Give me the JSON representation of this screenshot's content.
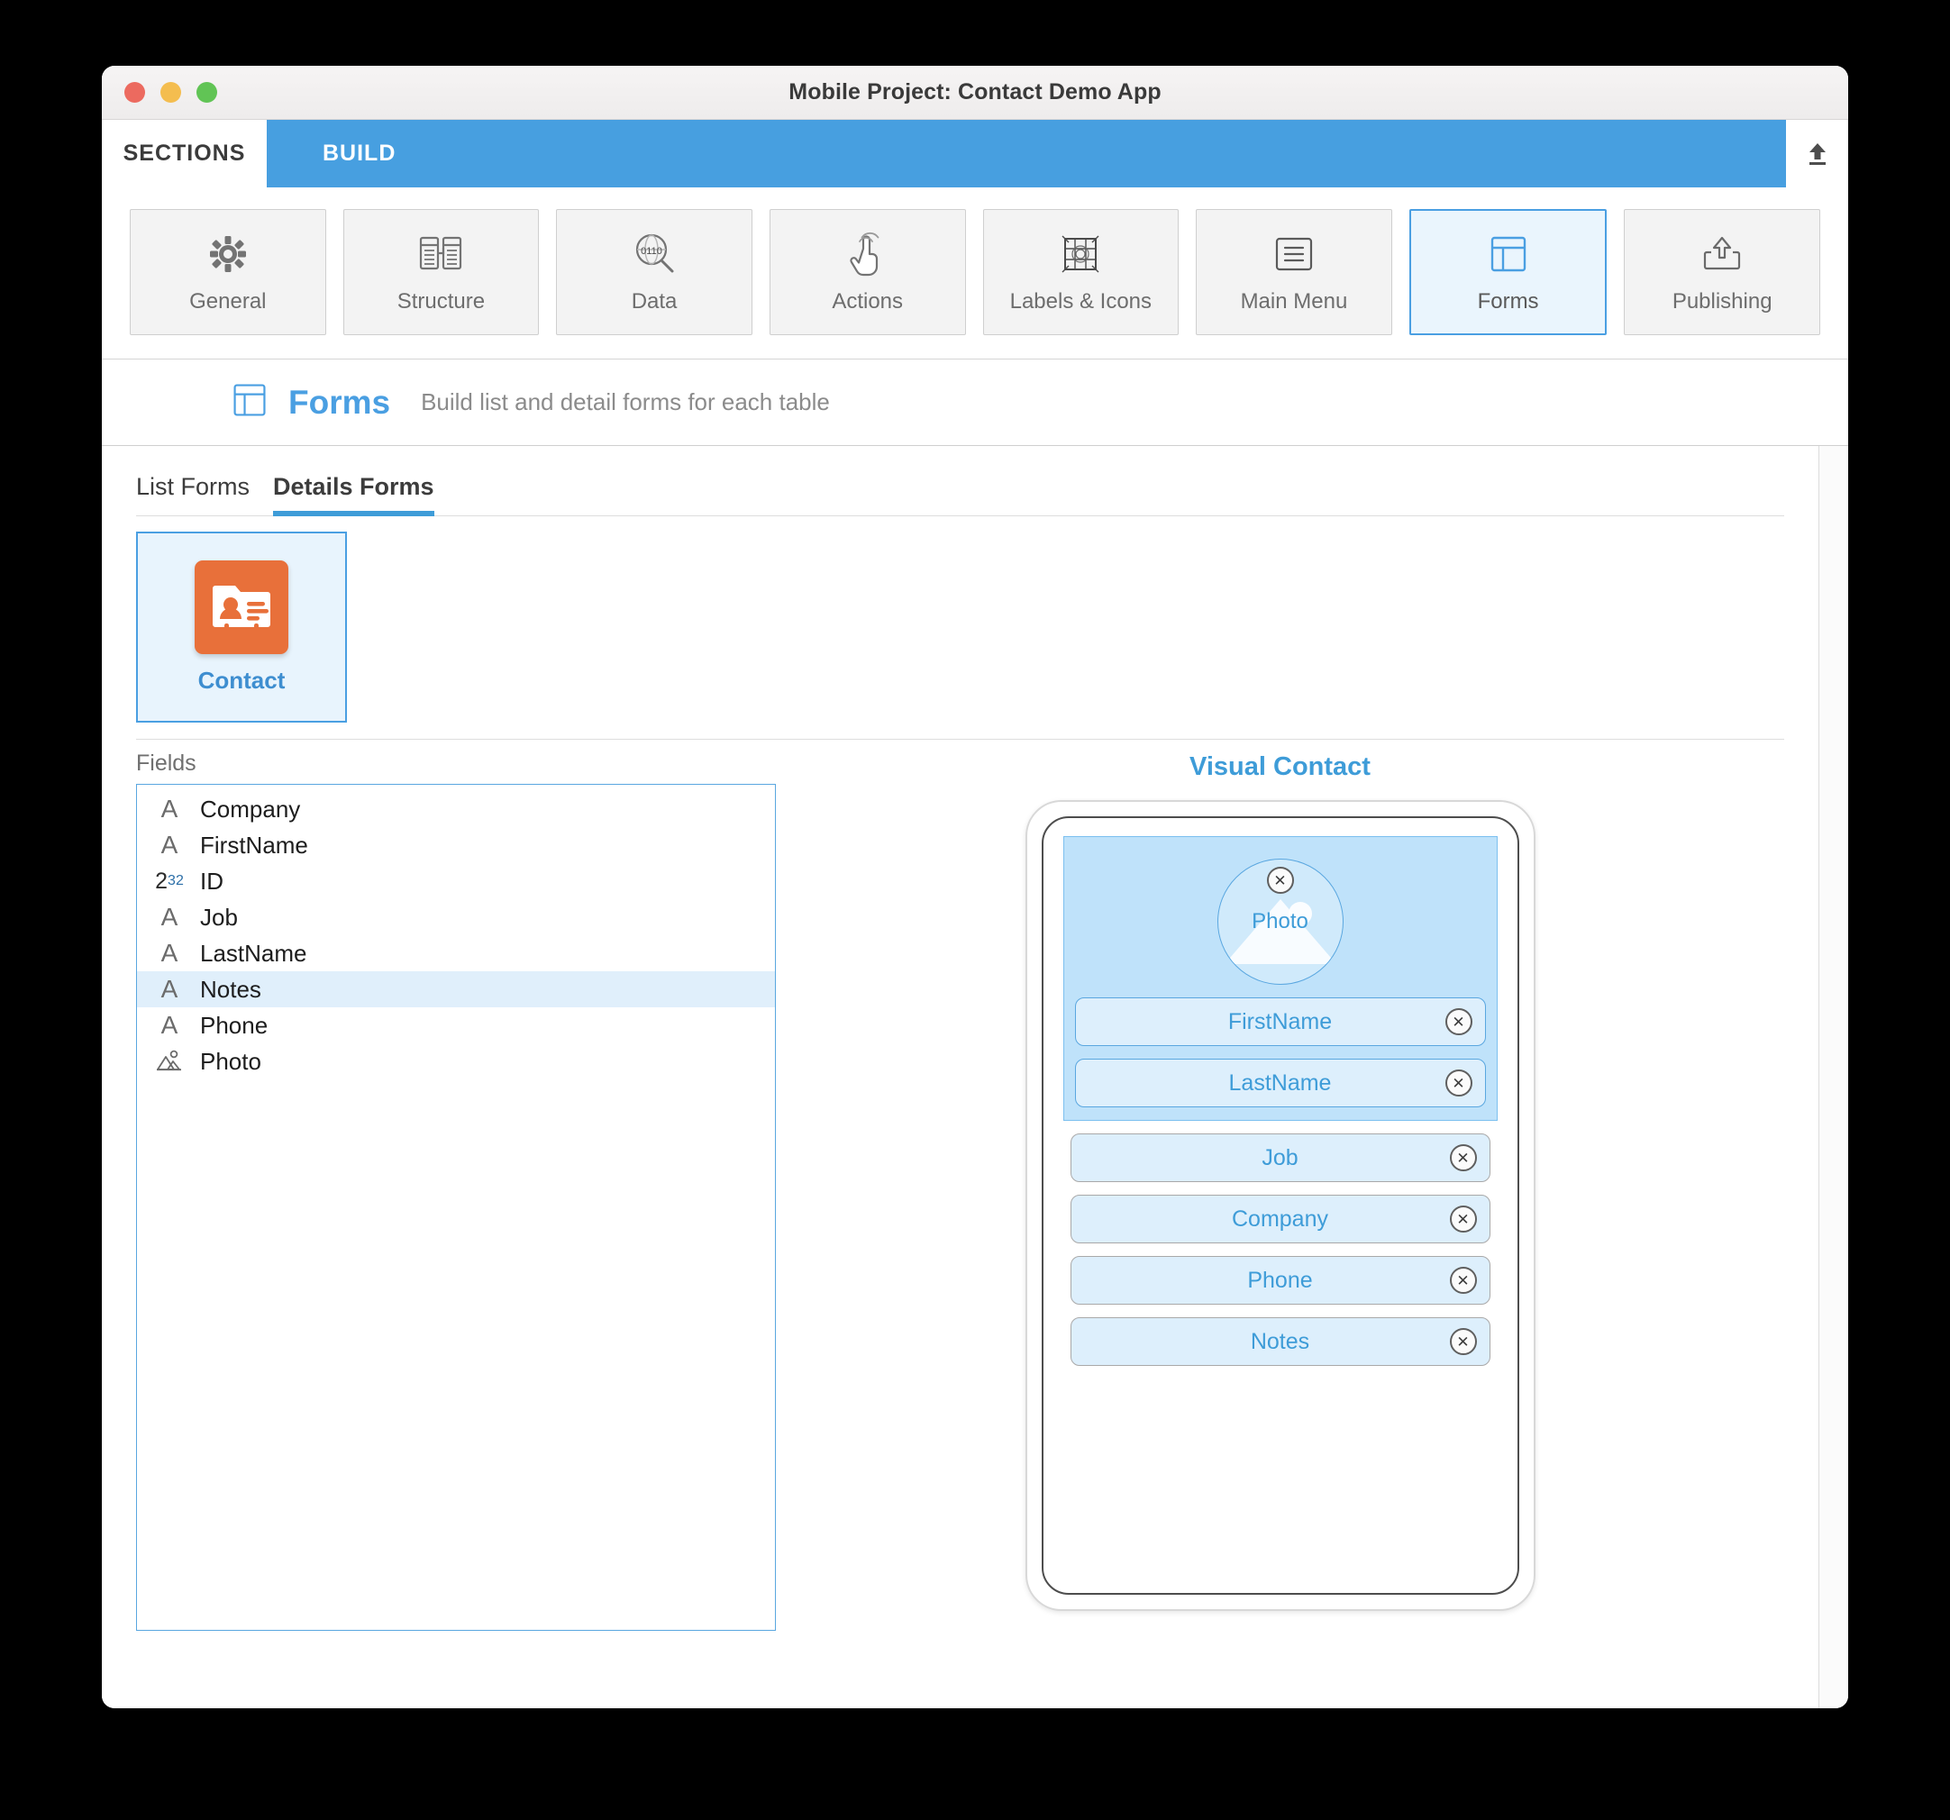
{
  "window": {
    "title": "Mobile Project: Contact Demo App",
    "traffic_lights": [
      "close-red",
      "minimize-yellow",
      "zoom-green"
    ]
  },
  "top_tabs": [
    {
      "label": "SECTIONS",
      "active": false
    },
    {
      "label": "BUILD",
      "active": true
    }
  ],
  "upload_button": {
    "icon": "upload-icon"
  },
  "toolbar": {
    "items": [
      {
        "label": "General",
        "icon": "gear-icon",
        "selected": false
      },
      {
        "label": "Structure",
        "icon": "structure-icon",
        "selected": false
      },
      {
        "label": "Data",
        "icon": "data-search-icon",
        "selected": false
      },
      {
        "label": "Actions",
        "icon": "tap-hand-icon",
        "selected": false
      },
      {
        "label": "Labels & Icons",
        "icon": "grid-icon",
        "selected": false
      },
      {
        "label": "Main Menu",
        "icon": "menu-icon",
        "selected": false
      },
      {
        "label": "Forms",
        "icon": "forms-layout-icon",
        "selected": true
      },
      {
        "label": "Publishing",
        "icon": "publish-icon",
        "selected": false
      }
    ]
  },
  "page_header": {
    "icon": "forms-layout-icon",
    "title": "Forms",
    "subtitle": "Build list and detail forms for each table"
  },
  "sub_tabs": [
    {
      "label": "List Forms",
      "active": false
    },
    {
      "label": "Details Forms",
      "active": true
    }
  ],
  "table_cards": [
    {
      "label": "Contact",
      "icon": "contact-card-icon",
      "selected": true
    }
  ],
  "fields_panel": {
    "caption": "Fields",
    "rows": [
      {
        "name": "Company",
        "type_icon": "text-type-icon",
        "type_glyph": "A",
        "selected": false
      },
      {
        "name": "FirstName",
        "type_icon": "text-type-icon",
        "type_glyph": "A",
        "selected": false
      },
      {
        "name": "ID",
        "type_icon": "number-type-icon",
        "type_glyph": "2",
        "type_sup": "32",
        "selected": false
      },
      {
        "name": "Job",
        "type_icon": "text-type-icon",
        "type_glyph": "A",
        "selected": false
      },
      {
        "name": "LastName",
        "type_icon": "text-type-icon",
        "type_glyph": "A",
        "selected": false
      },
      {
        "name": "Notes",
        "type_icon": "text-type-icon",
        "type_glyph": "A",
        "selected": true
      },
      {
        "name": "Phone",
        "type_icon": "text-type-icon",
        "type_glyph": "A",
        "selected": false
      },
      {
        "name": "Photo",
        "type_icon": "image-type-icon",
        "type_glyph": "",
        "selected": false
      }
    ]
  },
  "preview": {
    "title": "Visual Contact",
    "photo_area": {
      "avatar_label": "Photo",
      "remove_icon": "remove-circle-icon",
      "fields": [
        {
          "label": "FirstName",
          "remove_icon": "remove-circle-icon"
        },
        {
          "label": "LastName",
          "remove_icon": "remove-circle-icon"
        }
      ]
    },
    "fields": [
      {
        "label": "Job",
        "remove_icon": "remove-circle-icon"
      },
      {
        "label": "Company",
        "remove_icon": "remove-circle-icon"
      },
      {
        "label": "Phone",
        "remove_icon": "remove-circle-icon"
      },
      {
        "label": "Notes",
        "remove_icon": "remove-circle-icon"
      }
    ]
  },
  "colors": {
    "accent_blue": "#479fe0",
    "link_blue": "#3e9cd8",
    "selected_fill": "#eaf5fd",
    "table_icon_orange": "#e8703a",
    "photo_block_fill": "#bfe2fa",
    "field_fill": "#ddeffc"
  }
}
